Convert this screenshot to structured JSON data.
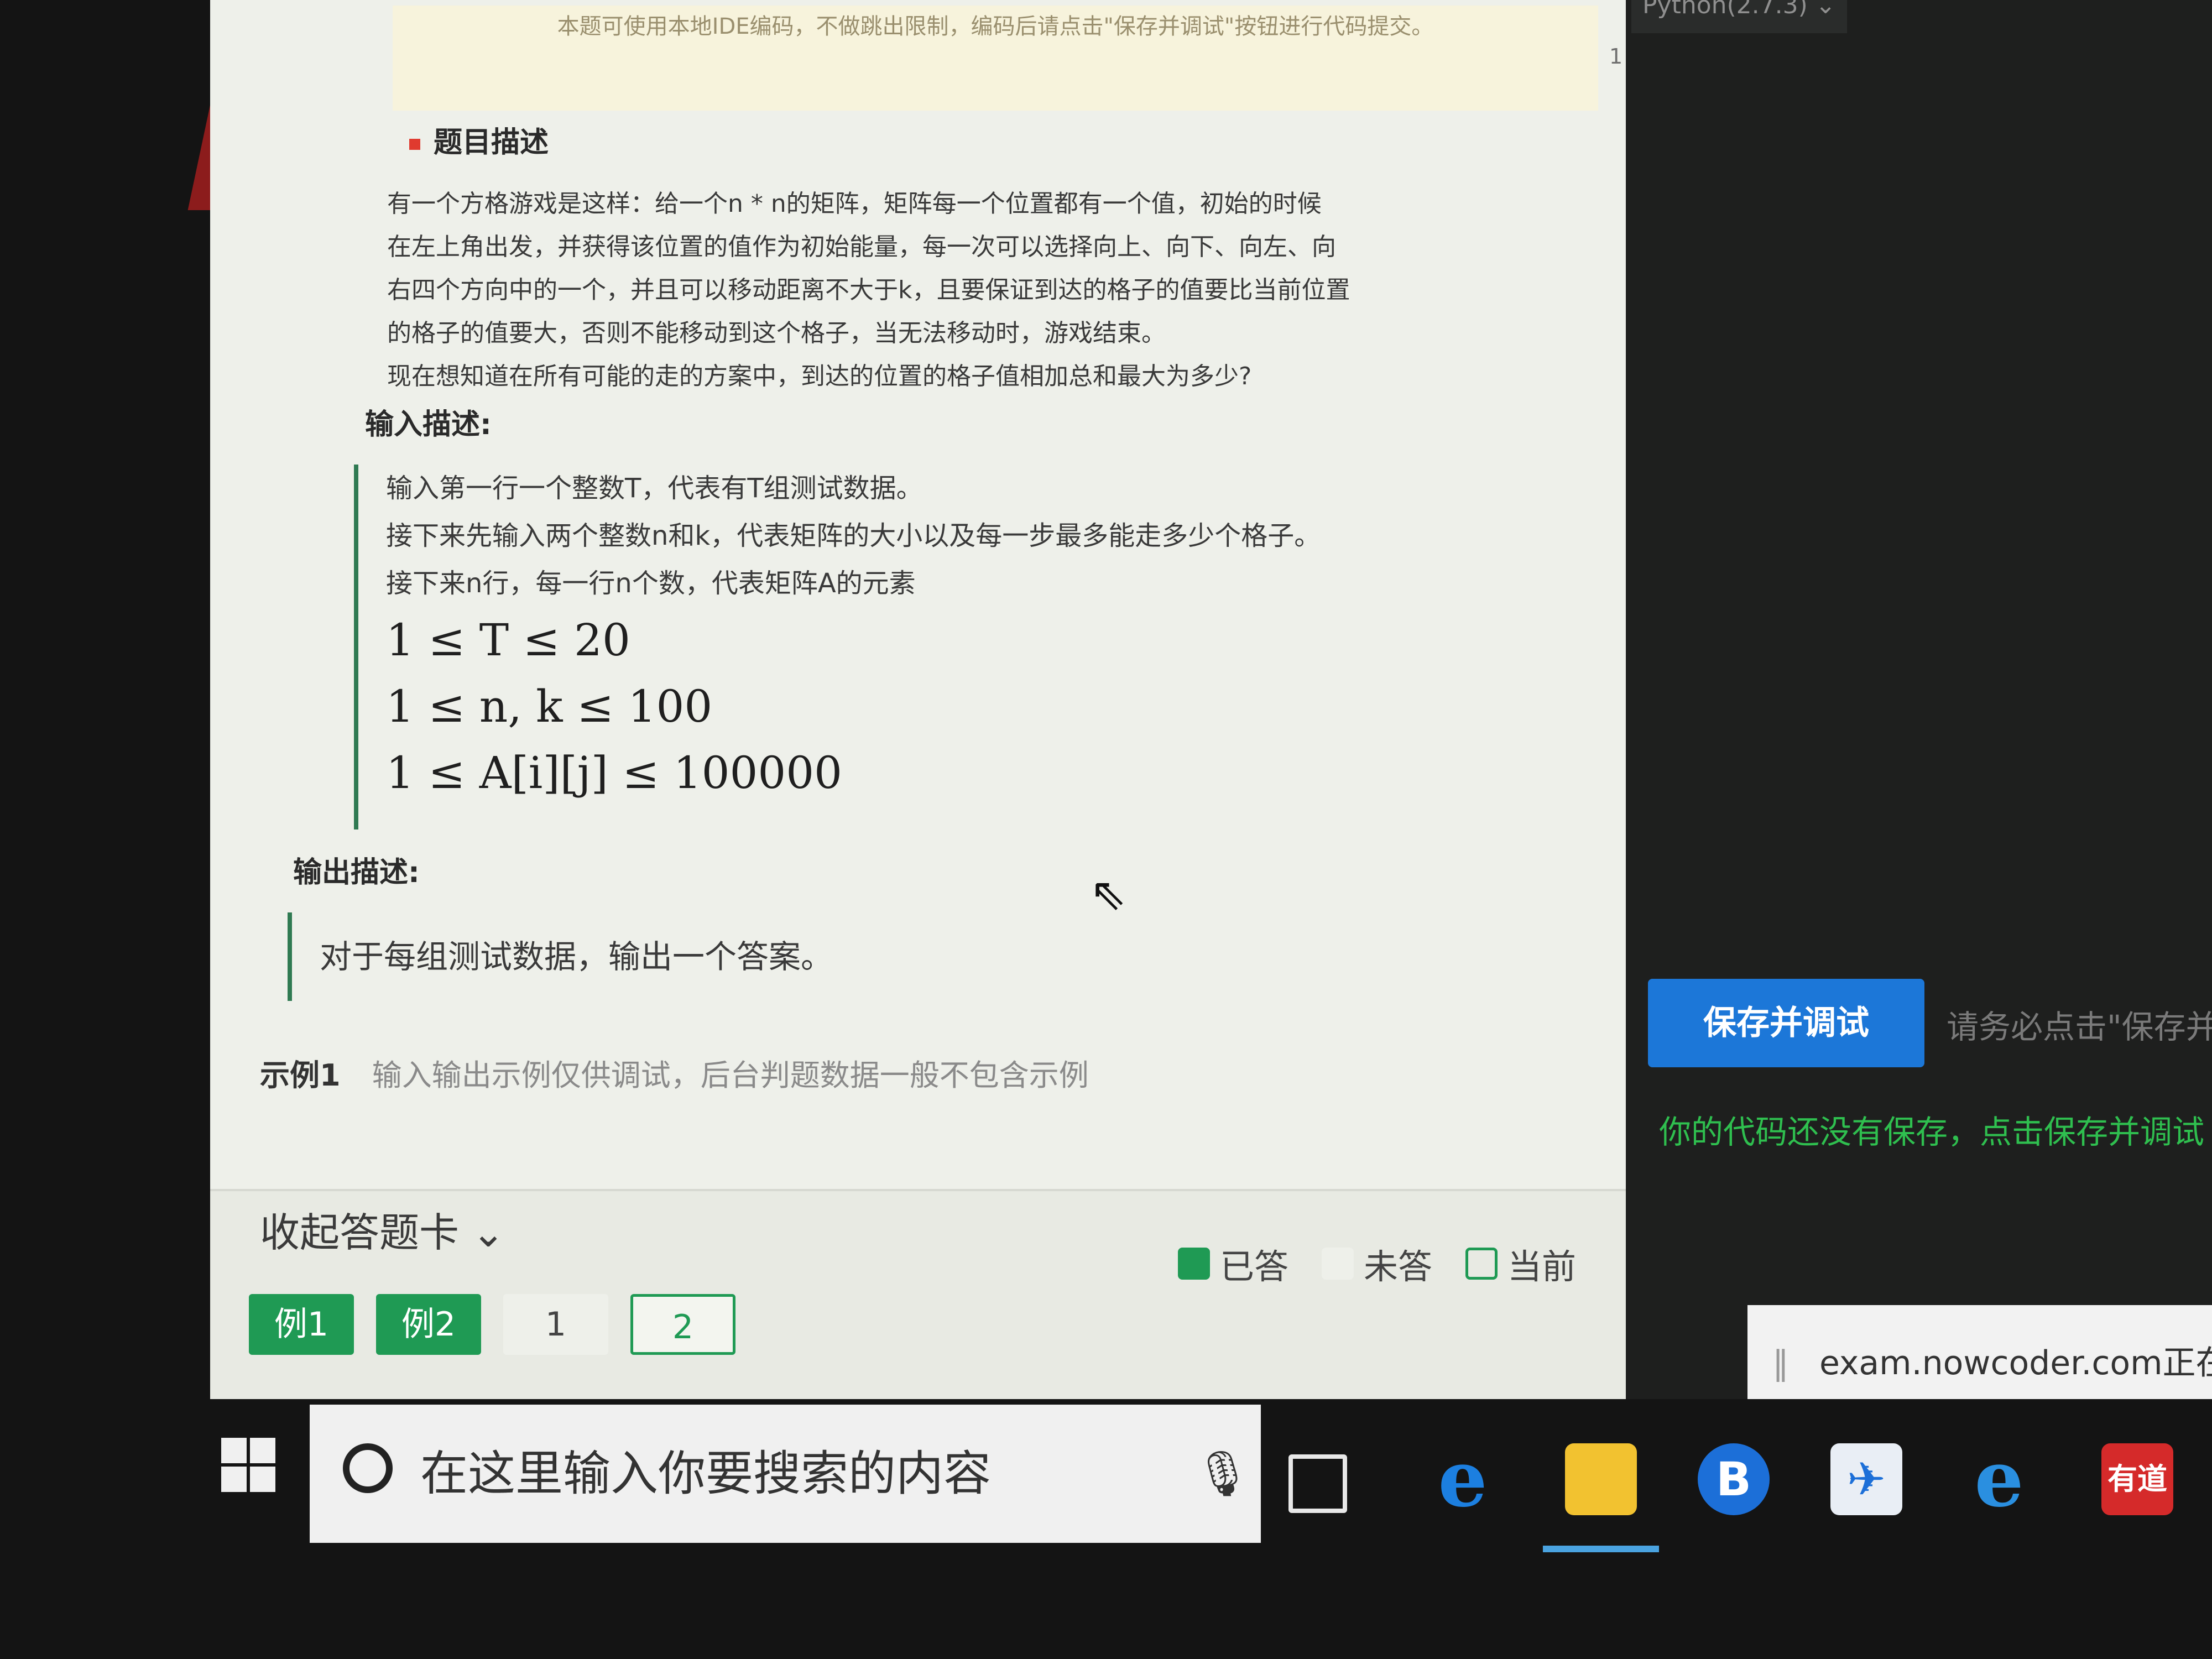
{
  "notice": {
    "text": "本题可使用本地IDE编码，不做跳出限制，编码后请点击\"保存并调试\"按钮进行代码提交。"
  },
  "problem": {
    "title": "题目描述",
    "desc_lines": [
      "有一个方格游戏是这样：给一个n * n的矩阵，矩阵每一个位置都有一个值，初始的时候",
      "在左上角出发，并获得该位置的值作为初始能量，每一次可以选择向上、向下、向左、向",
      "右四个方向中的一个，并且可以移动距离不大于k，且要保证到达的格子的值要比当前位置",
      "的格子的值要大，否则不能移动到这个格子，当无法移动时，游戏结束。",
      "现在想知道在所有可能的走的方案中，到达的位置的格子值相加总和最大为多少?"
    ],
    "input_title": "输入描述:",
    "input_lines": [
      "输入第一行一个整数T，代表有T组测试数据。",
      "接下来先输入两个整数n和k，代表矩阵的大小以及每一步最多能走多少个格子。",
      "接下来n行，每一行n个数，代表矩阵A的元素"
    ],
    "constraints": [
      "1 ≤ T ≤ 20",
      "1 ≤ n, k ≤ 100",
      "1 ≤ A[i][j] ≤ 100000"
    ],
    "output_title": "输出描述:",
    "output_text": "对于每组测试数据，输出一个答案。",
    "example_title": "示例1",
    "example_note": "输入输出示例仅供调试，后台判题数据一般不包含示例"
  },
  "answer_card": {
    "collapse_label": "收起答题卡",
    "legend": {
      "answered": "已答",
      "unanswered": "未答",
      "current": "当前"
    },
    "chips": [
      {
        "label": "例1",
        "state": "answered"
      },
      {
        "label": "例2",
        "state": "answered"
      },
      {
        "label": "1",
        "state": "unanswered"
      },
      {
        "label": "2",
        "state": "current"
      }
    ],
    "colors": {
      "answered": "#1f9a54",
      "current_border": "#1f9a54"
    }
  },
  "editor": {
    "language": "Python(2.7.3) ⌄",
    "line_number": "1",
    "save_button": "保存并调试",
    "save_hint": "请务必点击\"保存并",
    "unsaved_message": "你的代码还没有保存，点击保存并调试",
    "toast": "exam.nowcoder.com正在共"
  },
  "taskbar": {
    "search_placeholder": "在这里输入你要搜索的内容",
    "icons": [
      "windows-start-icon",
      "cortana-icon",
      "microphone-icon",
      "task-view-icon",
      "edge-icon",
      "file-explorer-icon",
      "b-app-icon",
      "feishu-icon",
      "internet-explorer-icon",
      "youdao-icon"
    ],
    "youdao_label": "有道",
    "b_label": "B",
    "e_label": "e"
  }
}
